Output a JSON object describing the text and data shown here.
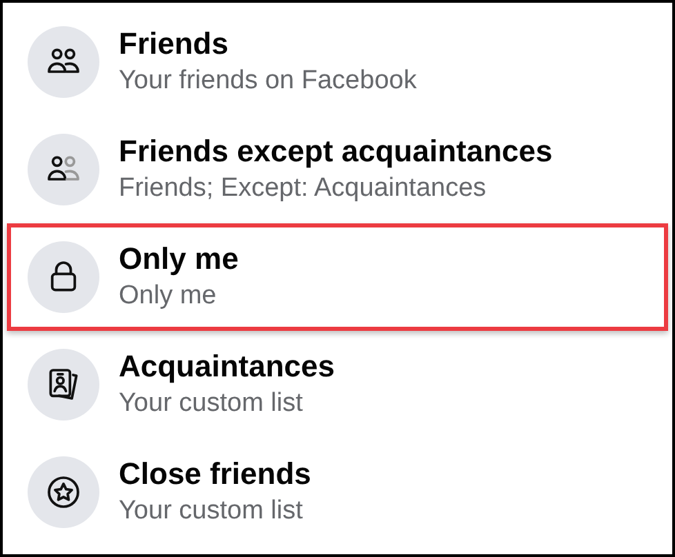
{
  "audience_options": [
    {
      "kind": "friends",
      "title": "Friends",
      "subtitle": "Your friends on Facebook",
      "highlighted": false
    },
    {
      "kind": "friends_except",
      "title": "Friends except acquaintances",
      "subtitle": "Friends; Except: Acquaintances",
      "highlighted": false
    },
    {
      "kind": "lock",
      "title": "Only me",
      "subtitle": "Only me",
      "highlighted": true
    },
    {
      "kind": "card",
      "title": "Acquaintances",
      "subtitle": "Your custom list",
      "highlighted": false
    },
    {
      "kind": "star",
      "title": "Close friends",
      "subtitle": "Your custom list",
      "highlighted": false
    }
  ]
}
